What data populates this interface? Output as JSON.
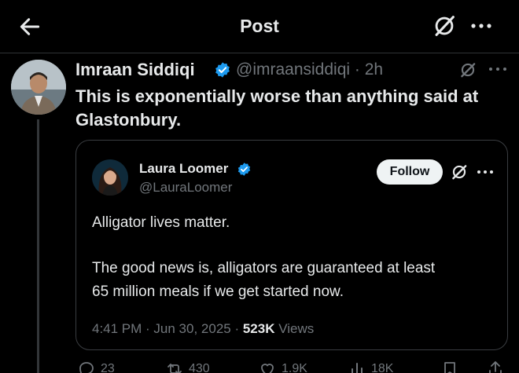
{
  "header": {
    "title": "Post",
    "back_icon": "arrow-left-icon",
    "grok_icon": "grok-icon",
    "more_icon": "more-dots-icon"
  },
  "tweet": {
    "author_name": "Imraan Siddiqi",
    "handle_time": "@imraansiddiqi · 2h",
    "verified": true,
    "text": "This is exponentially worse than anything said at Glastonbury."
  },
  "quoted": {
    "author_name": "Laura Loomer",
    "handle": "@LauraLoomer",
    "follow_label": "Follow",
    "line1": "Alligator lives matter.",
    "line2": "The good news is, alligators are guaranteed at least",
    "line3": "65 million meals if we get started now.",
    "timestamp": "4:41 PM · Jun 30, 2025 · ",
    "views_count": "523K",
    "views_label": "Views"
  },
  "actions": {
    "replies": "23",
    "reposts": "430",
    "likes": "1.9K",
    "views": "18K"
  },
  "colors": {
    "background": "#000000",
    "text": "#e7e9ea",
    "secondary": "#71767b",
    "verified": "#1d9bf0",
    "border": "#2f3336"
  }
}
